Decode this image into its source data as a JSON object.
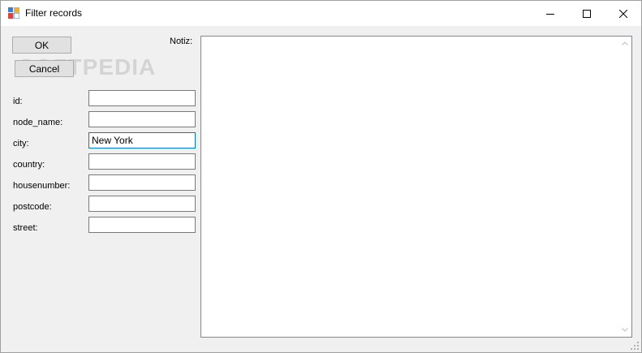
{
  "window": {
    "title": "Filter records"
  },
  "buttons": {
    "ok": "OK",
    "cancel": "Cancel"
  },
  "watermark": "SOFTPEDIA",
  "fields": [
    {
      "label": "id:",
      "value": ""
    },
    {
      "label": "node_name:",
      "value": ""
    },
    {
      "label": "city:",
      "value": "New York"
    },
    {
      "label": "country:",
      "value": ""
    },
    {
      "label": "housenumber:",
      "value": ""
    },
    {
      "label": "postcode:",
      "value": ""
    },
    {
      "label": "street:",
      "value": ""
    }
  ],
  "notiz": {
    "label": "Notiz:",
    "value": ""
  },
  "colors": {
    "focus": "#0078d7",
    "face": "#f0f0f0",
    "button": "#e1e1e1"
  }
}
